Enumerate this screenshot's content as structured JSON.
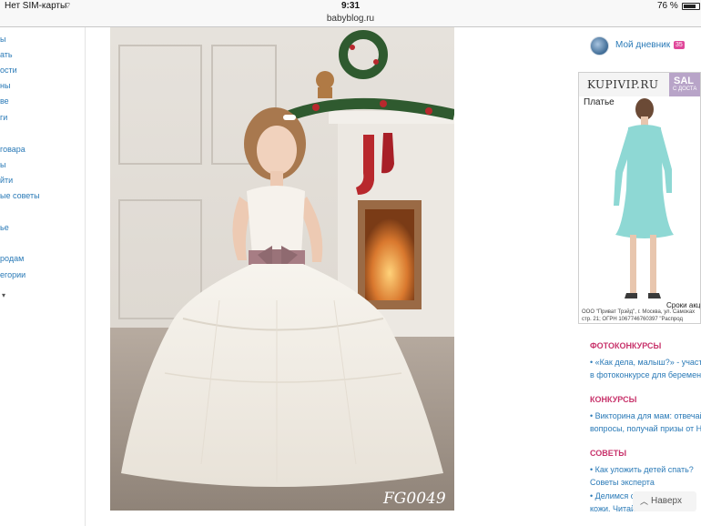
{
  "status_bar": {
    "carrier": "Нет SIM-карты",
    "time": "9:31",
    "battery": "76 %"
  },
  "address_bar": {
    "url": "babyblog.ru"
  },
  "left_nav": {
    "items": [
      "ы",
      "ать",
      "ости",
      "ны",
      "ве",
      "ги",
      "говара",
      "ы",
      "йти",
      "ые советы",
      "ье",
      "родам",
      "егории"
    ]
  },
  "photo": {
    "sku": "FG0049"
  },
  "sidebar": {
    "diary_label": "Мой дневник",
    "diary_count": "35",
    "ad": {
      "brand": "KUPIVIP.RU",
      "sale": "SAL",
      "delivery": "С ДОСТА",
      "product": "Платье",
      "terms": "Сроки акци",
      "legal_1": "ООО \"Приват Трэйд\", г. Москва, ул. Самоках",
      "legal_2": "стр. 21; ОГРН 1067746760397 \"Распрод"
    },
    "sections": [
      {
        "title": "ФОТОКОНКУРСЫ",
        "lines": [
          "• «Как дела, малыш?» - участву",
          "в фотоконкурсе для беременн"
        ]
      },
      {
        "title": "КОНКУРСЫ",
        "lines": [
          "• Викторина для мам: отвечай",
          "вопросы, получай призы от HiP"
        ]
      },
      {
        "title": "СОВЕТЫ",
        "lines": [
          "• Как уложить детей спать?",
          "Советы эксперта",
          "• Делимся с",
          "кожи. Читай"
        ]
      }
    ],
    "back_label": "Наверх"
  },
  "colors": {
    "link": "#2a7ab7",
    "section_title": "#c8336b",
    "badge": "#e0479a",
    "ad_dress": "#8ed8d4"
  }
}
